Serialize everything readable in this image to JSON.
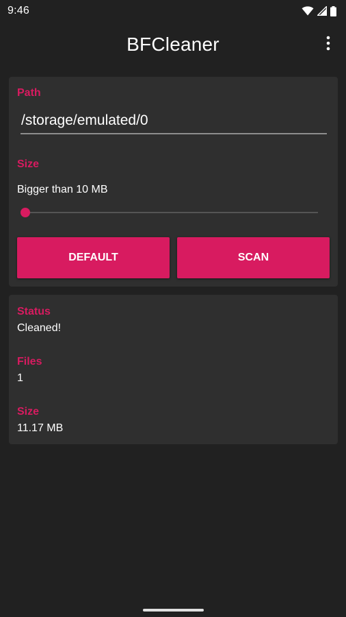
{
  "status_bar": {
    "time": "9:46",
    "icons": [
      "wifi-icon",
      "cellular-signal-icon",
      "battery-icon"
    ]
  },
  "app_bar": {
    "title": "BFCleaner",
    "menu_icon": "more-vert-icon"
  },
  "settings": {
    "path_label": "Path",
    "path_value": "/storage/emulated/0",
    "size_label": "Size",
    "size_text": "Bigger than 10 MB",
    "slider_level": 0,
    "default_button": "DEFAULT",
    "scan_button": "SCAN"
  },
  "status_card": {
    "status_label": "Status",
    "status_value": "Cleaned!",
    "files_label": "Files",
    "files_value": "1",
    "size_label": "Size",
    "size_value": "11.17 MB"
  },
  "colors": {
    "accent": "#d81b60",
    "background": "#212121",
    "card": "#2f2f2f"
  }
}
